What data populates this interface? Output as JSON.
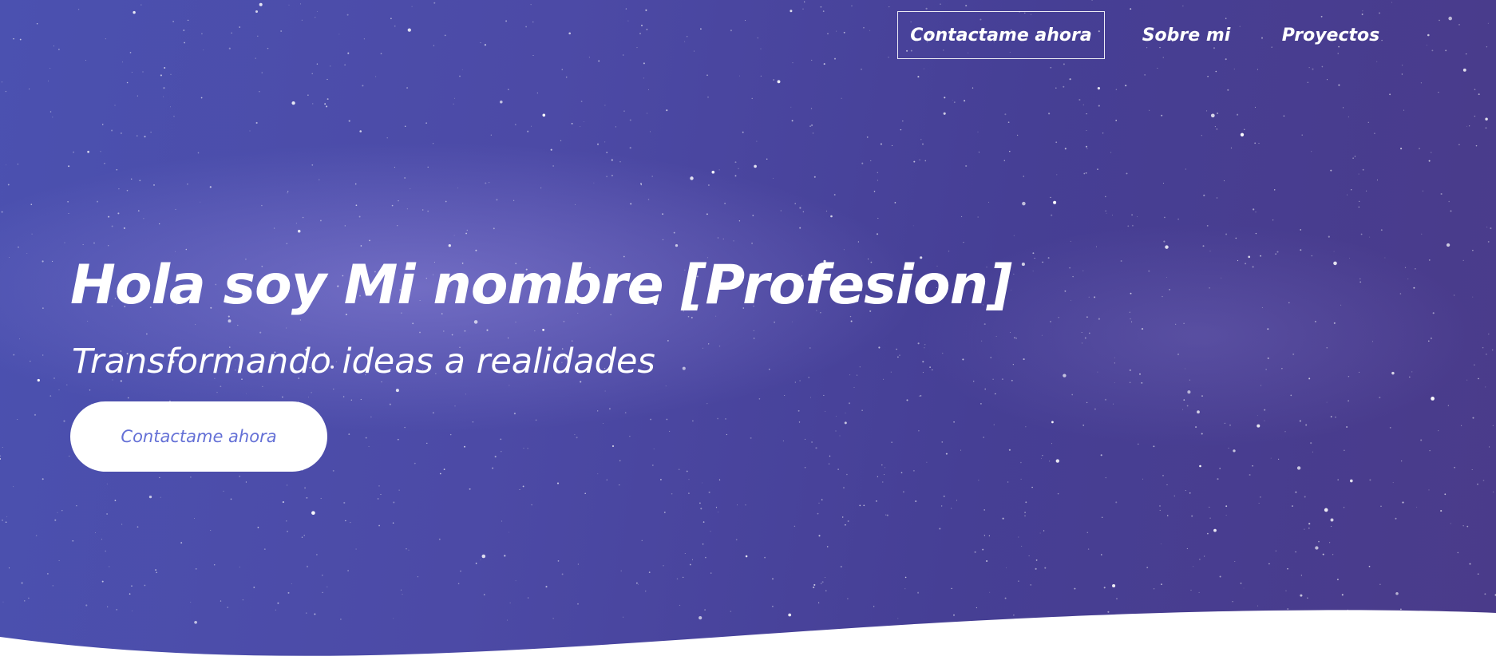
{
  "nav": {
    "items": [
      {
        "label": "Contactame ahora"
      },
      {
        "label": "Sobre mi"
      },
      {
        "label": "Proyectos"
      }
    ]
  },
  "hero": {
    "headline": "Hola soy Mi nombre [Profesion]",
    "subtitle": "Transformando ideas a realidades",
    "cta_label": "Contactame ahora"
  },
  "colors": {
    "background": "#4b4aa3",
    "accent_text": "#6470d6",
    "text": "#ffffff"
  }
}
